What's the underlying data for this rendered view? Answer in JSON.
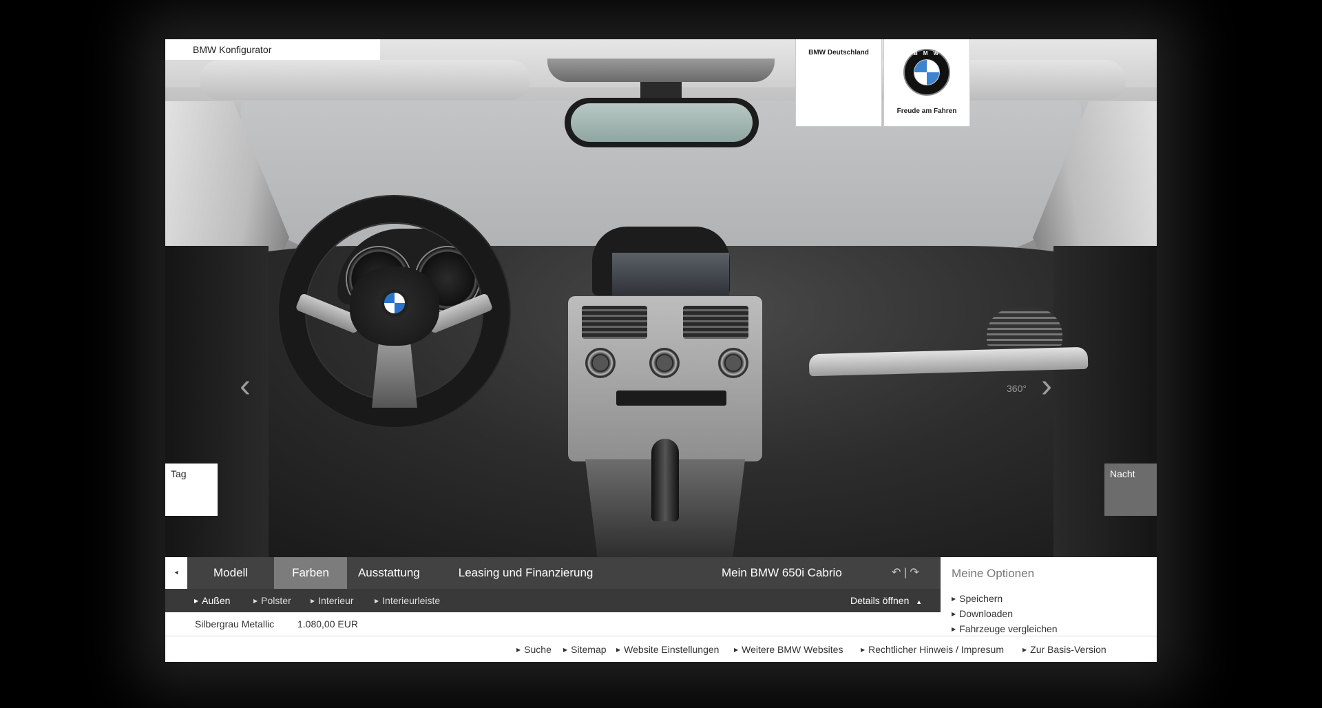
{
  "app": {
    "title": "BMW Konfigurator"
  },
  "brand": {
    "country_label": "BMW Deutschland",
    "logo_letters": "BMW",
    "slogan": "Freude am Fahren"
  },
  "viewer": {
    "left_arrow": "‹",
    "right_arrow": "›",
    "rotate_label": "360°",
    "day_label": "Tag",
    "night_label": "Nacht"
  },
  "nav": {
    "back_icon": "◂",
    "tabs": [
      {
        "label": "Modell"
      },
      {
        "label": "Farben",
        "active": true
      },
      {
        "label": "Ausstattung"
      },
      {
        "label": "Leasing und Finanzierung"
      }
    ],
    "my_bmw": "Mein BMW 650i Cabrio",
    "undo_redo": "↶ | ↷"
  },
  "subnav": {
    "items": [
      {
        "label": "Außen",
        "active": true
      },
      {
        "label": "Polster"
      },
      {
        "label": "Interieur"
      },
      {
        "label": "Interieurleiste"
      }
    ],
    "details_label": "Details öffnen",
    "details_icon": "▲"
  },
  "selection": {
    "color_name": "Silbergrau Metallic",
    "price": "1.080,00 EUR"
  },
  "options": {
    "title": "Meine Optionen",
    "items": [
      "Speichern",
      "Downloaden",
      "Fahrzeuge vergleichen"
    ]
  },
  "footer": {
    "links": [
      "Suche",
      "Sitemap",
      "Website Einstellungen",
      "Weitere BMW Websites",
      "Rechtlicher Hinweis / Impresum",
      "Zur Basis-Version"
    ]
  },
  "colors": {
    "nav_bg": "#464646",
    "active_tab": "#7c7c7c",
    "bmw_blue": "#3c83d0"
  }
}
